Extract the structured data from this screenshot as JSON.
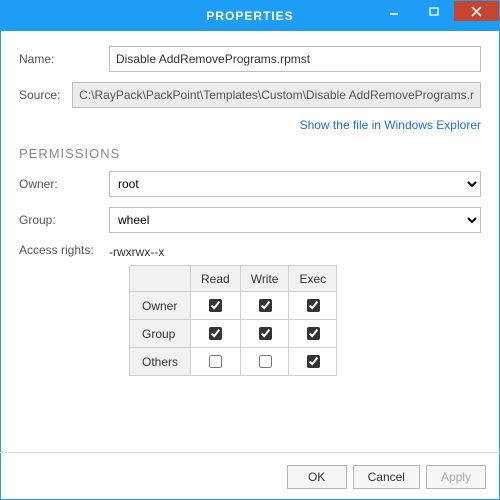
{
  "window": {
    "title": "PROPERTIES"
  },
  "labels": {
    "name": "Name:",
    "source": "Source:",
    "permissions_header": "PERMISSIONS",
    "owner": "Owner:",
    "group": "Group:",
    "access_rights": "Access rights:",
    "read": "Read",
    "write": "Write",
    "exec": "Exec",
    "row_owner": "Owner",
    "row_group": "Group",
    "row_others": "Others"
  },
  "fields": {
    "name_value": "Disable AddRemovePrograms.rpmst",
    "source_value": "C:\\RayPack\\PackPoint\\Templates\\Custom\\Disable AddRemovePrograms.r",
    "owner_selected": "root",
    "group_selected": "wheel",
    "access_rights_string": "-rwxrwx--x"
  },
  "link": {
    "explorer": "Show the file in Windows Explorer"
  },
  "permissions_matrix": {
    "owner": {
      "read": true,
      "write": true,
      "exec": true
    },
    "group": {
      "read": true,
      "write": true,
      "exec": true
    },
    "others": {
      "read": false,
      "write": false,
      "exec": true
    }
  },
  "buttons": {
    "ok": "OK",
    "cancel": "Cancel",
    "apply": "Apply"
  }
}
